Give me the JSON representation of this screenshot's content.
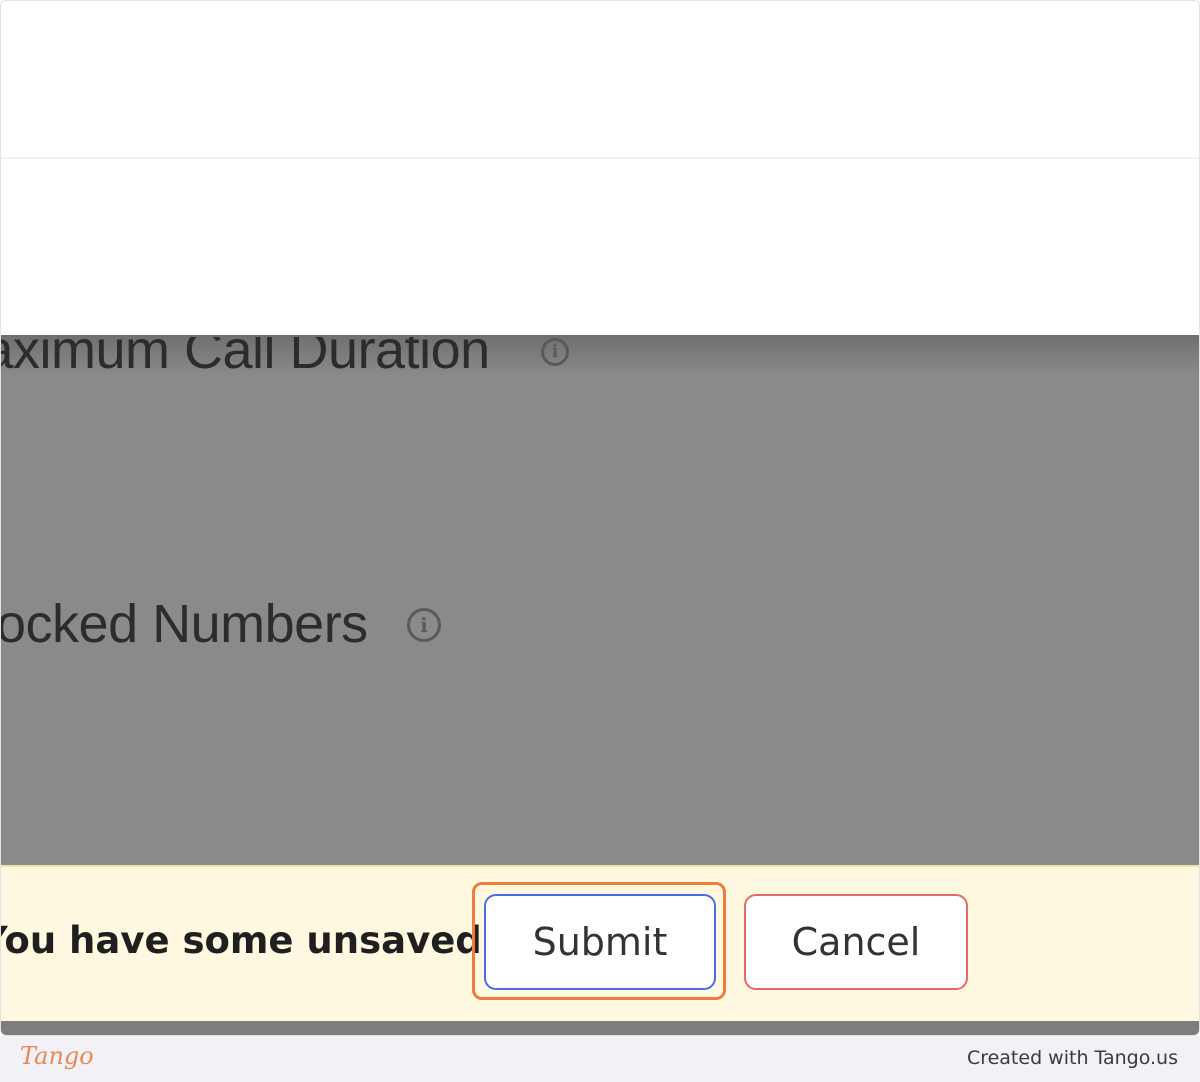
{
  "settings": {
    "max_call_duration_label": "Maximum Call Duration",
    "blocked_numbers_label": "Blocked Numbers",
    "info_glyph": "i"
  },
  "unsaved_bar": {
    "message": "You have some unsaved changes",
    "submit_label": "Submit",
    "cancel_label": "Cancel"
  },
  "footer": {
    "logo": "Tango",
    "credit": "Created with Tango.us"
  },
  "colors": {
    "highlight": "#f07b3f",
    "submit_border": "#4a6fe3",
    "cancel_border": "#e46a6a",
    "unsaved_bg": "#fff8e1"
  },
  "icons": [
    "info-icon"
  ]
}
